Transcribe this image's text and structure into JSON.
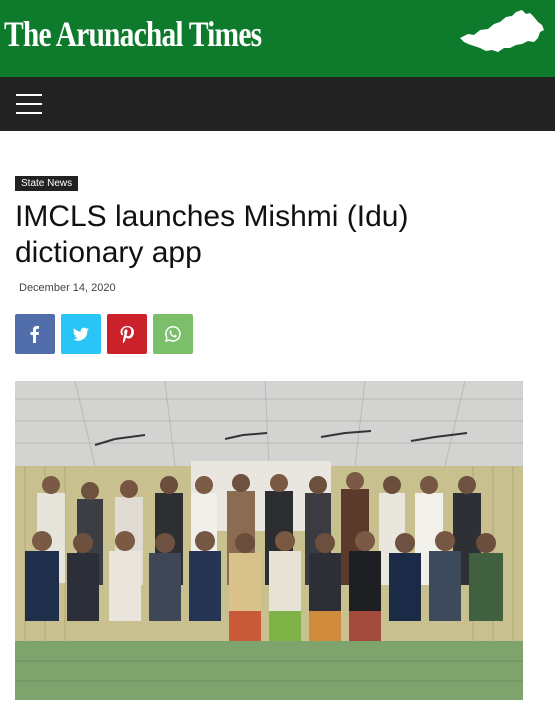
{
  "site": {
    "name": "The Arunachal Times",
    "brand_color": "#0d7a2c",
    "nav_color": "#222222"
  },
  "nav": {
    "menu_icon": "hamburger-menu-icon"
  },
  "article": {
    "category": "State News",
    "title": "IMCLS launches Mishmi (Idu) dictionary app",
    "date": "December 14, 2020"
  },
  "share_buttons": [
    {
      "network": "facebook",
      "icon": "facebook-icon",
      "color": "#516eab"
    },
    {
      "network": "twitter",
      "icon": "twitter-icon",
      "color": "#29c5f6"
    },
    {
      "network": "pinterest",
      "icon": "pinterest-icon",
      "color": "#ca212a"
    },
    {
      "network": "whatsapp",
      "icon": "whatsapp-icon",
      "color": "#7bbf6a"
    }
  ],
  "featured_image": {
    "subject": "group-photo"
  }
}
